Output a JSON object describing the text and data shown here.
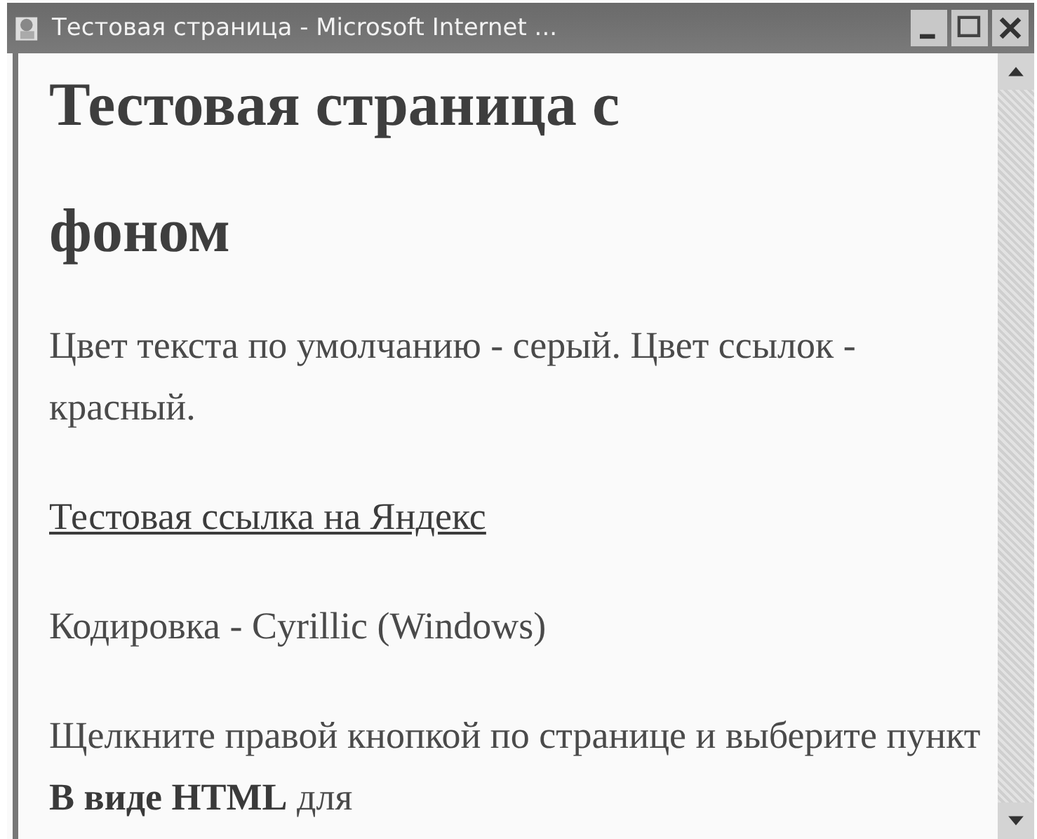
{
  "window": {
    "title": "Тестовая страница - Microsoft Internet ..."
  },
  "page": {
    "heading": "Тестовая страница с фоном",
    "blocks": [
      {
        "kind": "text",
        "text": "Цвет текста по умолчанию - серый. Цвет ссылок - красный."
      },
      {
        "kind": "link",
        "text": "Тестовая ссылка на Яндекс"
      },
      {
        "kind": "text",
        "text": "Кодировка - Cyrillic (Windows)"
      },
      {
        "kind": "text",
        "text": "Щелкните правой кнопкой по странице и выберите пункт **В виде HTML** для"
      }
    ]
  }
}
